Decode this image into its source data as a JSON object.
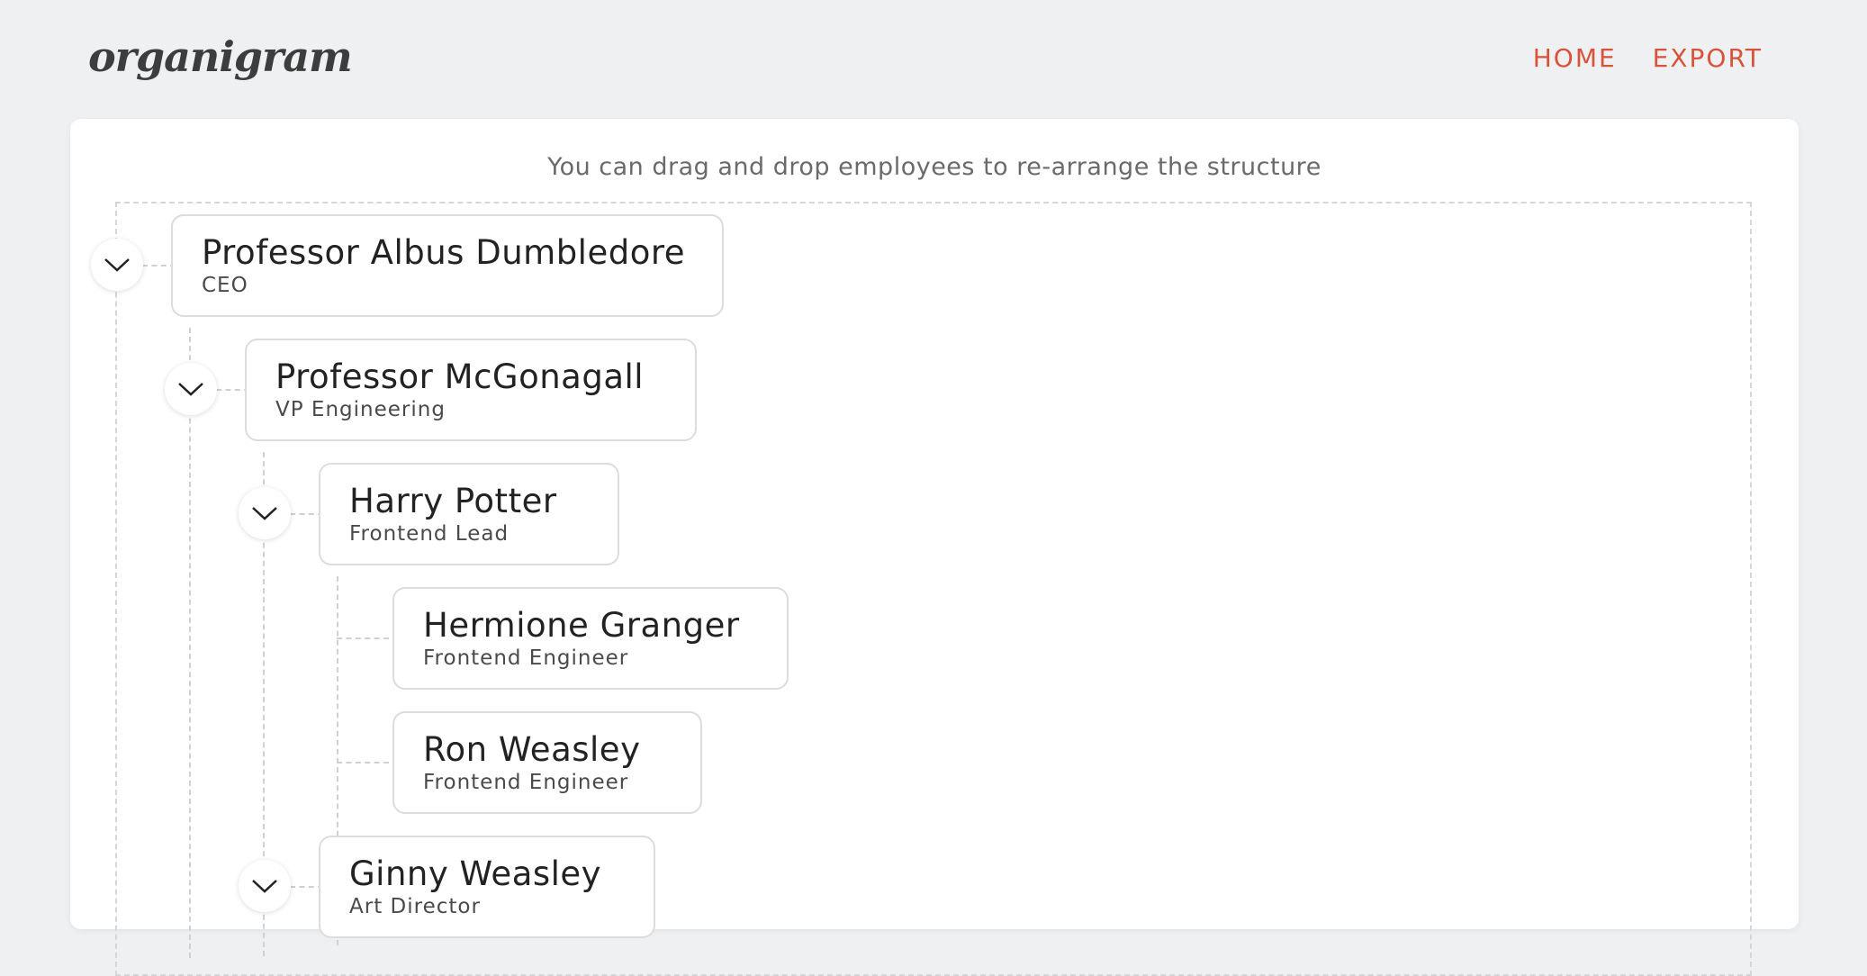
{
  "app": {
    "logo": "organigram"
  },
  "nav": {
    "home": "HOME",
    "export": "EXPORT"
  },
  "colors": {
    "accent": "#d9533b",
    "background": "#eff0f2",
    "card": "#ffffff"
  },
  "hint": "You can drag and drop employees to re-arrange the structure",
  "employees": [
    {
      "name": "Professor Albus Dumbledore",
      "title": "CEO",
      "expanded": true
    },
    {
      "name": "Professor McGonagall",
      "title": "VP Engineering",
      "expanded": true
    },
    {
      "name": "Harry Potter",
      "title": "Frontend Lead",
      "expanded": true
    },
    {
      "name": "Hermione Granger",
      "title": "Frontend Engineer"
    },
    {
      "name": "Ron Weasley",
      "title": "Frontend Engineer"
    },
    {
      "name": "Ginny Weasley",
      "title": "Art Director",
      "expanded": true
    }
  ],
  "icons": {
    "toggle": "chevron-down-icon"
  }
}
